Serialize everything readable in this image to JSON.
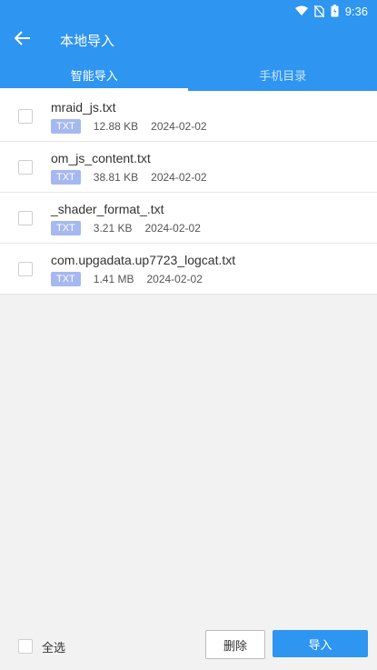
{
  "status_bar": {
    "time": "9:36",
    "icons": [
      "wifi-icon",
      "no-sim-icon",
      "battery-icon"
    ]
  },
  "header": {
    "title": "本地导入",
    "back_icon": "arrow-left-icon"
  },
  "tabs": [
    {
      "label": "智能导入",
      "active": true
    },
    {
      "label": "手机目录",
      "active": false
    }
  ],
  "files": [
    {
      "name": "mraid_js.txt",
      "type": "TXT",
      "size": "12.88 KB",
      "date": "2024-02-02"
    },
    {
      "name": "om_js_content.txt",
      "type": "TXT",
      "size": "38.81 KB",
      "date": "2024-02-02"
    },
    {
      "name": "_shader_format_.txt",
      "type": "TXT",
      "size": "3.21 KB",
      "date": "2024-02-02"
    },
    {
      "name": "com.upgadata.up7723_logcat.txt",
      "type": "TXT",
      "size": "1.41 MB",
      "date": "2024-02-02"
    }
  ],
  "bottom": {
    "select_all_label": "全选",
    "delete_label": "删除",
    "import_label": "导入"
  },
  "colors": {
    "primary": "#2e95f0",
    "badge": "#a5b8f0"
  }
}
